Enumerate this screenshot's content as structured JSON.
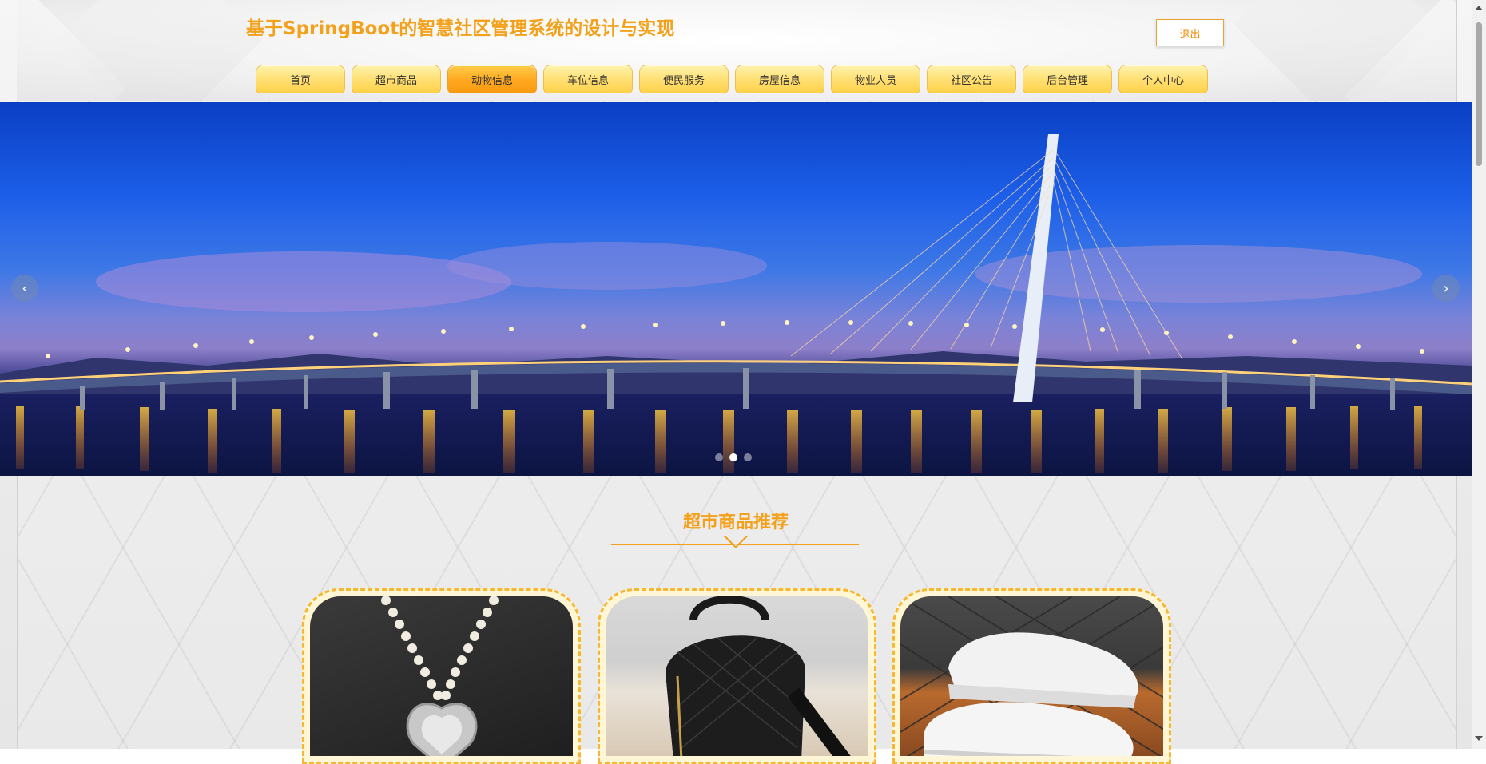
{
  "site": {
    "title": "基于SpringBoot的智慧社区管理系统的设计与实现",
    "logout_label": "退出"
  },
  "nav": {
    "items": [
      {
        "label": "首页",
        "icon": "nav-tab"
      },
      {
        "label": "超市商品",
        "icon": "nav-tab"
      },
      {
        "label": "动物信息",
        "icon": "nav-tab"
      },
      {
        "label": "车位信息",
        "icon": "nav-tab"
      },
      {
        "label": "便民服务",
        "icon": "nav-tab"
      },
      {
        "label": "房屋信息",
        "icon": "nav-tab"
      },
      {
        "label": "物业人员",
        "icon": "nav-tab"
      },
      {
        "label": "社区公告",
        "icon": "nav-tab"
      },
      {
        "label": "后台管理",
        "icon": "nav-tab"
      },
      {
        "label": "个人中心",
        "icon": "nav-tab"
      }
    ],
    "active_index": 2
  },
  "banner": {
    "slide_count": 3,
    "active_slide": 2,
    "prev_icon": "‹",
    "next_icon": "›",
    "image_subject": "cable-stayed bridge at night"
  },
  "section": {
    "title": "超市商品推荐"
  },
  "products": [
    {
      "image_subject": "pearl heart necklace"
    },
    {
      "image_subject": "black quilted backpack"
    },
    {
      "image_subject": "white sneakers"
    }
  ],
  "colors": {
    "accent": "#f3a11b",
    "nav_tab": "#ffe27a",
    "nav_tab_active": "#ffa820",
    "card_border": "#f7b733"
  }
}
